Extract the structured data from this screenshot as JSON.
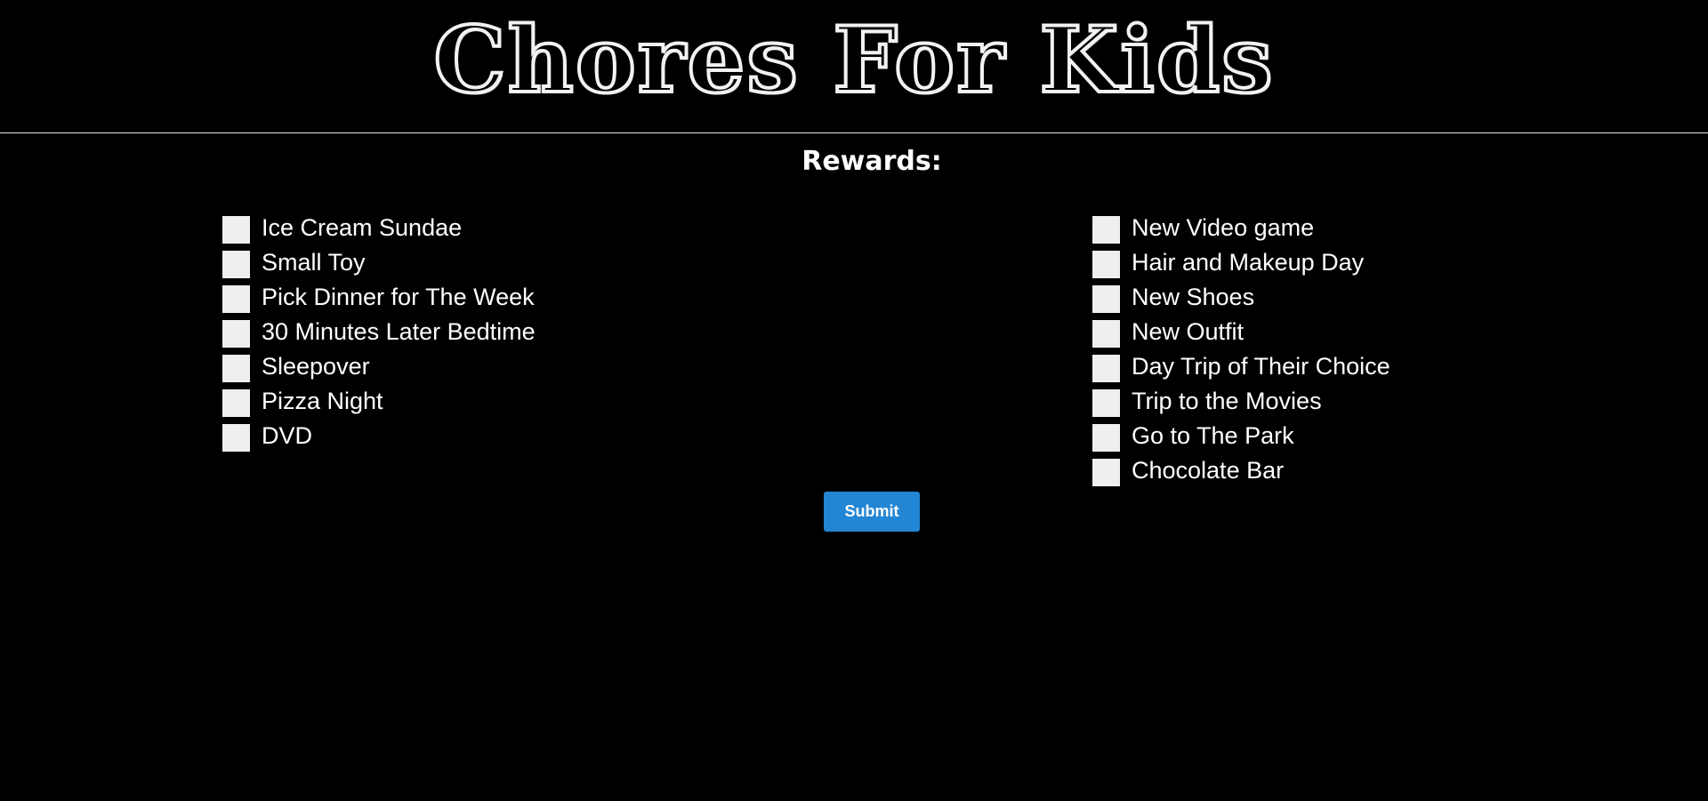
{
  "header": {
    "title": "Chores For Kids"
  },
  "rewards": {
    "title": "Rewards:",
    "left": [
      {
        "label": "Ice Cream Sundae"
      },
      {
        "label": "Small Toy"
      },
      {
        "label": "Pick Dinner for The Week"
      },
      {
        "label": "30 Minutes Later Bedtime"
      },
      {
        "label": "Sleepover"
      },
      {
        "label": "Pizza Night"
      },
      {
        "label": "DVD"
      }
    ],
    "right": [
      {
        "label": "New Video game"
      },
      {
        "label": "Hair and Makeup Day"
      },
      {
        "label": "New Shoes"
      },
      {
        "label": "New Outfit"
      },
      {
        "label": "Day Trip of Their Choice"
      },
      {
        "label": "Trip to the Movies"
      },
      {
        "label": "Go to The Park"
      },
      {
        "label": "Chocolate Bar"
      }
    ]
  },
  "form": {
    "submit_label": "Submit"
  },
  "colors": {
    "background": "#000000",
    "text": "#ffffff",
    "checkbox": "#efefef",
    "button": "#2386d4"
  }
}
